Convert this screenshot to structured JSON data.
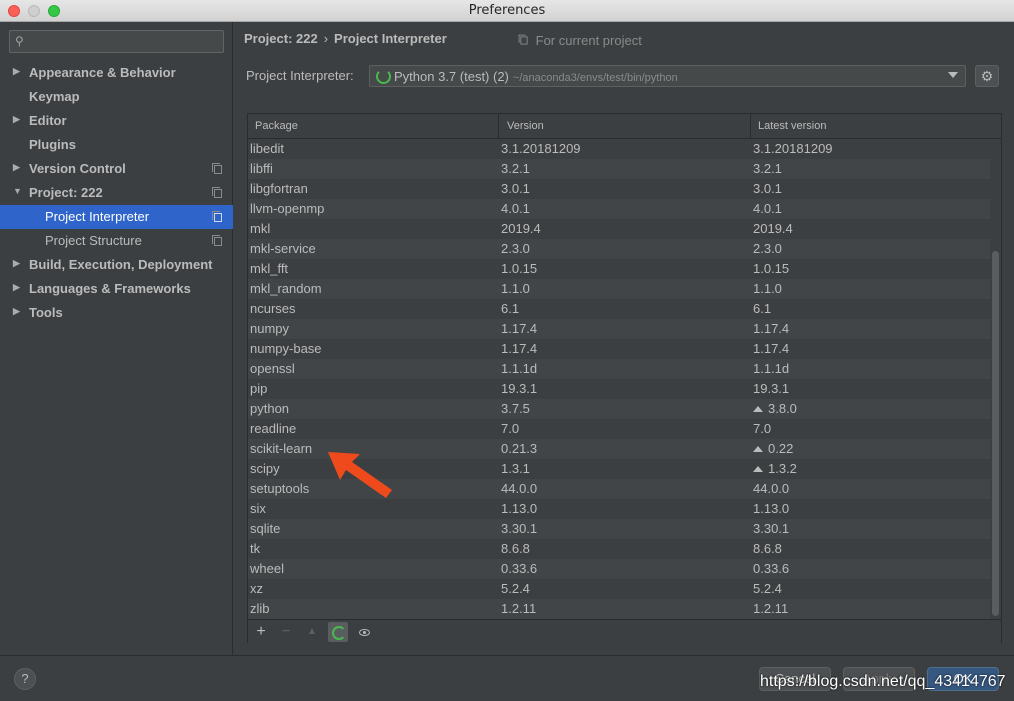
{
  "window": {
    "title": "Preferences"
  },
  "sidebar": {
    "search": {
      "placeholder": ""
    },
    "items": [
      {
        "label": "Appearance & Behavior",
        "arrow": "▶"
      },
      {
        "label": "Keymap",
        "arrow": ""
      },
      {
        "label": "Editor",
        "arrow": "▶"
      },
      {
        "label": "Plugins",
        "arrow": ""
      },
      {
        "label": "Version Control",
        "arrow": "▶"
      },
      {
        "label": "Project: 222",
        "arrow": "▼"
      },
      {
        "label": "Project Interpreter",
        "arrow": ""
      },
      {
        "label": "Project Structure",
        "arrow": ""
      },
      {
        "label": "Build, Execution, Deployment",
        "arrow": "▶"
      },
      {
        "label": "Languages & Frameworks",
        "arrow": "▶"
      },
      {
        "label": "Tools",
        "arrow": "▶"
      }
    ]
  },
  "breadcrumb": {
    "project": "Project: 222",
    "separator": "›",
    "page": "Project Interpreter",
    "scope": "For current project"
  },
  "interpreter": {
    "label": "Project Interpreter:",
    "name": "Python 3.7 (test) (2)",
    "path": "~/anaconda3/envs/test/bin/python"
  },
  "table": {
    "headers": [
      "Package",
      "Version",
      "Latest version"
    ],
    "rows": [
      [
        "libedit",
        "3.1.20181209",
        "3.1.20181209",
        false
      ],
      [
        "libffi",
        "3.2.1",
        "3.2.1",
        false
      ],
      [
        "libgfortran",
        "3.0.1",
        "3.0.1",
        false
      ],
      [
        "llvm-openmp",
        "4.0.1",
        "4.0.1",
        false
      ],
      [
        "mkl",
        "2019.4",
        "2019.4",
        false
      ],
      [
        "mkl-service",
        "2.3.0",
        "2.3.0",
        false
      ],
      [
        "mkl_fft",
        "1.0.15",
        "1.0.15",
        false
      ],
      [
        "mkl_random",
        "1.1.0",
        "1.1.0",
        false
      ],
      [
        "ncurses",
        "6.1",
        "6.1",
        false
      ],
      [
        "numpy",
        "1.17.4",
        "1.17.4",
        false
      ],
      [
        "numpy-base",
        "1.17.4",
        "1.17.4",
        false
      ],
      [
        "openssl",
        "1.1.1d",
        "1.1.1d",
        false
      ],
      [
        "pip",
        "19.3.1",
        "19.3.1",
        false
      ],
      [
        "python",
        "3.7.5",
        "3.8.0",
        true
      ],
      [
        "readline",
        "7.0",
        "7.0",
        false
      ],
      [
        "scikit-learn",
        "0.21.3",
        "0.22",
        true
      ],
      [
        "scipy",
        "1.3.1",
        "1.3.2",
        true
      ],
      [
        "setuptools",
        "44.0.0",
        "44.0.0",
        false
      ],
      [
        "six",
        "1.13.0",
        "1.13.0",
        false
      ],
      [
        "sqlite",
        "3.30.1",
        "3.30.1",
        false
      ],
      [
        "tk",
        "8.6.8",
        "8.6.8",
        false
      ],
      [
        "wheel",
        "0.33.6",
        "0.33.6",
        false
      ],
      [
        "xz",
        "5.2.4",
        "5.2.4",
        false
      ],
      [
        "zlib",
        "1.2.11",
        "1.2.11",
        false
      ]
    ]
  },
  "toolbar": {
    "add": "+",
    "remove": "−",
    "upgrade": "▲"
  },
  "footer": {
    "help": "?",
    "cancel": "Cancel",
    "apply": "Apply",
    "ok": "OK",
    "watermark": "https://blog.csdn.net/qq_43414767"
  },
  "colors": {
    "accent": "#2f65ca",
    "annotation_arrow": "#ee4a1c",
    "spinner": "#48b84f"
  }
}
